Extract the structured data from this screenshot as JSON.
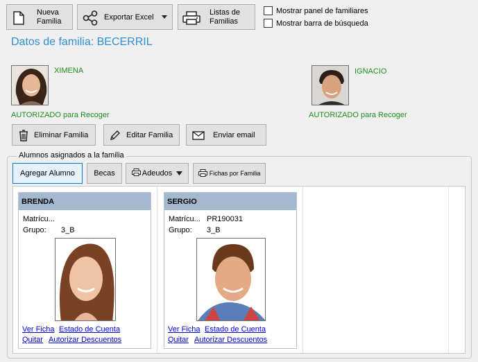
{
  "toolbar": {
    "nueva_familia": "Nueva\nFamilia",
    "nueva_familia_l1": "Nueva",
    "nueva_familia_l2": "Familia",
    "exportar_excel": "Exportar Excel",
    "listas_l1": "Listas de",
    "listas_l2": "Familias",
    "chk_panel": "Mostrar panel de familiares",
    "chk_busqueda": "Mostrar barra de búsqueda"
  },
  "family": {
    "title": "Datos de familia: BECERRIL",
    "member1": {
      "name": "XIMENA",
      "status": "AUTORIZADO para Recoger"
    },
    "member2": {
      "name": "IGNACIO",
      "status": "AUTORIZADO para Recoger"
    }
  },
  "actions": {
    "eliminar": "Eliminar Familia",
    "editar": "Editar Familia",
    "email": "Enviar email"
  },
  "students_section": {
    "legend": "Alumnos asignados a la familia",
    "agregar": "Agregar Alumno",
    "becas": "Becas",
    "adeudos": "Adeudos",
    "fichas": "Fichas por Familia"
  },
  "students": [
    {
      "name": "BRENDA",
      "matricula_label": "Matrícu...",
      "matricula_value": "",
      "grupo_label": "Grupo:",
      "grupo_value": "3_B",
      "ver_ficha": "Ver Ficha",
      "estado": "Estado de Cuenta",
      "quitar": "Quitar",
      "autorizar": "Autorizar Descuentos"
    },
    {
      "name": "SERGIO",
      "matricula_label": "Matrícu...",
      "matricula_value": "PR190031",
      "grupo_label": "Grupo:",
      "grupo_value": "3_B",
      "ver_ficha": "Ver Ficha",
      "estado": "Estado de Cuenta",
      "quitar": "Quitar",
      "autorizar": "Autorizar Descuentos"
    }
  ],
  "colors": {
    "title_blue": "#2f8fd6",
    "status_green": "#1d8d1d",
    "card_header": "#a4b8cf"
  }
}
